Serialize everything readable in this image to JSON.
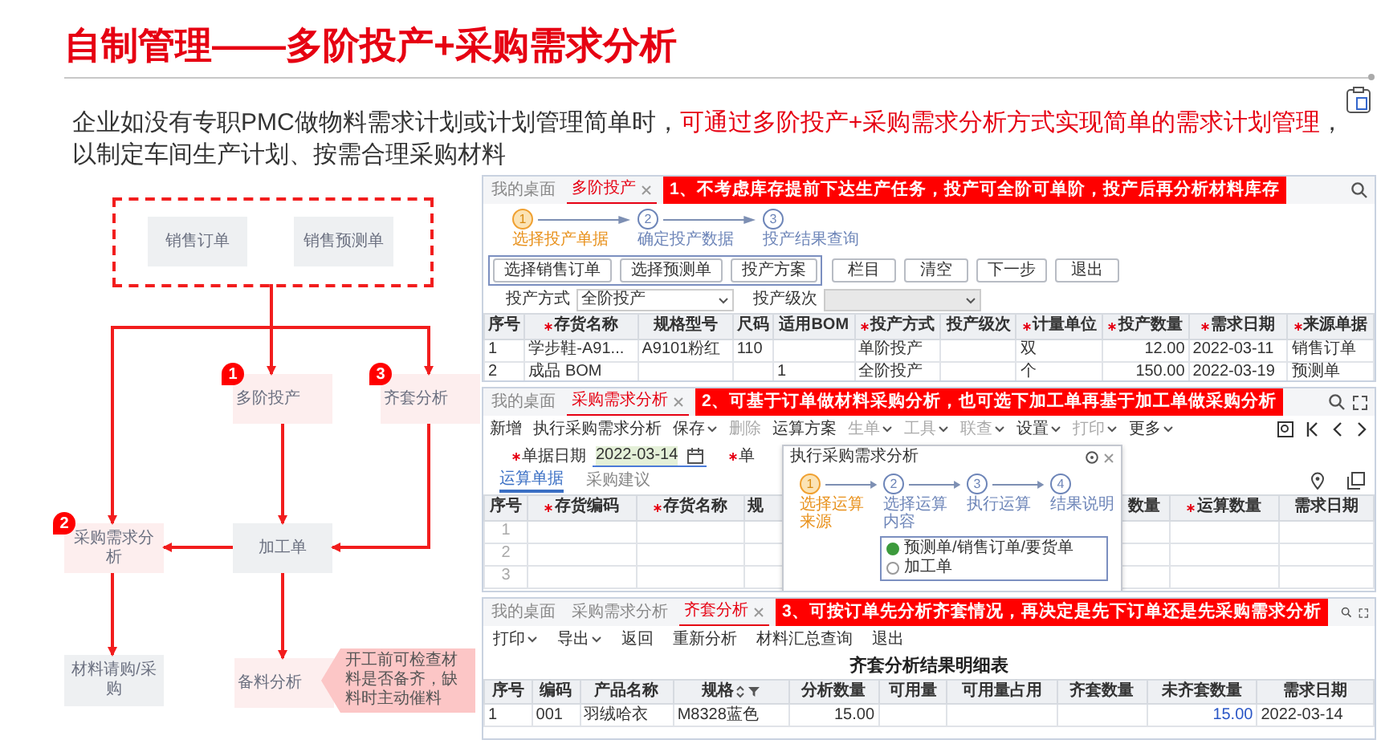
{
  "title": "自制管理——多阶投产+采购需求分析",
  "intro": [
    {
      "text": "企业如没有专职PMC做物料需求计划或计划管理简单时，",
      "highlight": false
    },
    {
      "text": "可通过多阶投产+采购需求分析方式实现简单的需求计划管理",
      "highlight": true
    },
    {
      "text": "，以制定车间生产计划、按需合理采购材料",
      "highlight": false
    }
  ],
  "flowchart": {
    "sources": [
      "销售订单",
      "销售预测单"
    ],
    "nodes": [
      {
        "label": "多阶投产",
        "kind": "step",
        "badge": "1"
      },
      {
        "label": "齐套分析",
        "kind": "step",
        "badge": "3"
      },
      {
        "label": "采购需求分析",
        "kind": "step",
        "badge": "2"
      },
      {
        "label": "加工单",
        "kind": "plain"
      },
      {
        "label": "材料请购/采购",
        "kind": "plain"
      },
      {
        "label": "备料分析",
        "kind": "step"
      }
    ],
    "note": "开工前可检查材料是否备齐，缺料时主动催料"
  },
  "production_panel": {
    "tabs": [
      {
        "label": "我的桌面",
        "selected": false,
        "closable": false
      },
      {
        "label": "多阶投产",
        "selected": true,
        "closable": true
      }
    ],
    "callout": "1、不考虑库存提前下达生产任务，投产可全阶可单阶，投产后再分析材料库存",
    "steps": [
      {
        "num": "1",
        "label": "选择投产单据",
        "current": true
      },
      {
        "num": "2",
        "label": "确定投产数据",
        "current": false
      },
      {
        "num": "3",
        "label": "投产结果查询",
        "current": false
      }
    ],
    "button_groups": [
      {
        "framed": true,
        "buttons": [
          "选择销售订单",
          "选择预测单",
          "投产方案"
        ]
      },
      {
        "framed": false,
        "buttons": [
          "栏目",
          "清空",
          "下一步",
          "退出"
        ]
      }
    ],
    "fields": [
      {
        "label": "投产方式",
        "value": "全阶投产",
        "disabled": false
      },
      {
        "label": "投产级次",
        "disabled": true
      }
    ],
    "columns": [
      {
        "label": "序号",
        "required": false
      },
      {
        "label": "存货名称",
        "required": true
      },
      {
        "label": "规格型号",
        "required": false
      },
      {
        "label": "尺码",
        "required": false
      },
      {
        "label": "适用BOM",
        "required": false
      },
      {
        "label": "投产方式",
        "required": true
      },
      {
        "label": "投产级次",
        "required": false
      },
      {
        "label": "计量单位",
        "required": true
      },
      {
        "label": "投产数量",
        "required": true,
        "kind": "number"
      },
      {
        "label": "需求日期",
        "required": true
      },
      {
        "label": "来源单据",
        "required": true
      }
    ],
    "rows": [
      [
        "1",
        "学步鞋-A91...",
        "A9101粉红",
        "110",
        "",
        "单阶投产",
        "",
        "双",
        "12.00",
        "2022-03-11",
        "销售订单"
      ],
      [
        "2",
        "成品 BOM",
        "",
        "",
        "1",
        "全阶投产",
        "",
        "个",
        "150.00",
        "2022-03-19",
        "预测单"
      ]
    ]
  },
  "purchase_panel": {
    "tabs": [
      {
        "label": "我的桌面",
        "selected": false,
        "closable": false
      },
      {
        "label": "采购需求分析",
        "selected": true,
        "closable": true
      }
    ],
    "callout": "2、可基于订单做材料采购分析，也可选下加工单再基于加工单做采购分析",
    "toolbar": [
      {
        "label": "新增",
        "disabled": false,
        "dropdown": false
      },
      {
        "label": "执行采购需求分析",
        "disabled": false,
        "dropdown": false
      },
      {
        "label": "保存",
        "disabled": false,
        "dropdown": true
      },
      {
        "label": "删除",
        "disabled": true,
        "dropdown": false
      },
      {
        "label": "运算方案",
        "disabled": false,
        "dropdown": false
      },
      {
        "label": "生单",
        "disabled": true,
        "dropdown": true
      },
      {
        "label": "工具",
        "disabled": true,
        "dropdown": true
      },
      {
        "label": "联查",
        "disabled": true,
        "dropdown": true
      },
      {
        "label": "设置",
        "disabled": false,
        "dropdown": true
      },
      {
        "label": "打印",
        "disabled": true,
        "dropdown": true
      },
      {
        "label": "更多",
        "disabled": false,
        "dropdown": true
      }
    ],
    "fields": [
      {
        "label": "单据日期",
        "required": true,
        "value": "2022-03-14"
      },
      {
        "label": "单",
        "required": true
      }
    ],
    "subtabs": [
      {
        "label": "运算单据",
        "selected": true
      },
      {
        "label": "采购建议",
        "selected": false
      }
    ],
    "columns": [
      {
        "label": "序号",
        "required": false
      },
      {
        "label": "存货编码",
        "required": true
      },
      {
        "label": "存货名称",
        "required": true
      },
      {
        "label": "规",
        "required": false
      },
      {
        "label": "数量",
        "required": false
      },
      {
        "label": "运算数量",
        "required": true
      },
      {
        "label": "需求日期",
        "required": false
      }
    ],
    "row_numbers": [
      "1",
      "2",
      "3"
    ],
    "dialog": {
      "title": "执行采购需求分析",
      "steps": [
        {
          "num": "1",
          "label": "选择运算来源",
          "current": true
        },
        {
          "num": "2",
          "label": "选择运算内容",
          "current": false
        },
        {
          "num": "3",
          "label": "执行运算",
          "current": false
        },
        {
          "num": "4",
          "label": "结果说明",
          "current": false
        }
      ],
      "options": [
        {
          "label": "预测单/销售订单/要货单",
          "selected": true
        },
        {
          "label": "加工单",
          "selected": false
        }
      ]
    }
  },
  "kitting_panel": {
    "tabs": [
      {
        "label": "我的桌面",
        "selected": false,
        "closable": false
      },
      {
        "label": "采购需求分析",
        "selected": false,
        "closable": false
      },
      {
        "label": "齐套分析",
        "selected": true,
        "closable": true
      }
    ],
    "callout": "3、可按订单先分析齐套情况，再决定是先下订单还是先采购需求分析",
    "toolbar": [
      {
        "label": "打印",
        "dropdown": true
      },
      {
        "label": "导出",
        "dropdown": true
      },
      {
        "label": "返回",
        "dropdown": false
      },
      {
        "label": "重新分析",
        "dropdown": false
      },
      {
        "label": "材料汇总查询",
        "dropdown": false
      },
      {
        "label": "退出",
        "dropdown": false
      }
    ],
    "report_title": "齐套分析结果明细表",
    "columns": [
      {
        "label": "序号"
      },
      {
        "label": "编码"
      },
      {
        "label": "产品名称"
      },
      {
        "label": "规格",
        "kind": "sortable"
      },
      {
        "label": "分析数量",
        "kind": "number"
      },
      {
        "label": "可用量"
      },
      {
        "label": "可用量占用"
      },
      {
        "label": "齐套数量"
      },
      {
        "label": "未齐套数量",
        "kind": "link"
      },
      {
        "label": "需求日期"
      }
    ],
    "rows": [
      [
        "1",
        "001",
        "羽绒哈衣",
        "M8328蓝色",
        "15.00",
        "",
        "",
        "",
        "15.00",
        "2022-03-14"
      ]
    ]
  }
}
